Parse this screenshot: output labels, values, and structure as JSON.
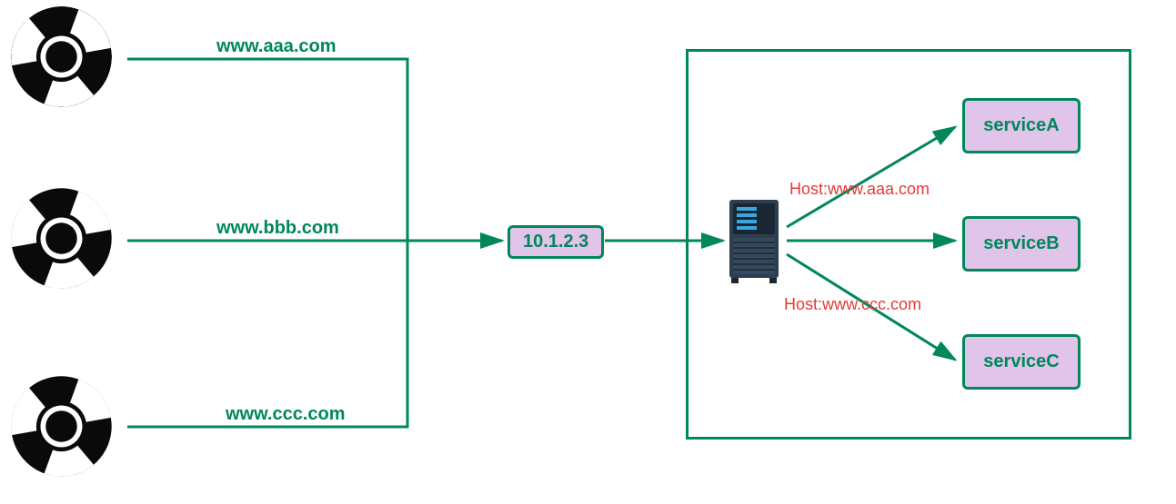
{
  "browsers": [
    {
      "domain": "www.aaa.com"
    },
    {
      "domain": "www.bbb.com"
    },
    {
      "domain": "www.ccc.com"
    }
  ],
  "ip": "10.1.2.3",
  "services": [
    {
      "name": "serviceA"
    },
    {
      "name": "serviceB"
    },
    {
      "name": "serviceC"
    }
  ],
  "host_labels": [
    "Host:www.aaa.com",
    "Host:www.ccc.com"
  ],
  "colors": {
    "green": "#00875a",
    "purple": "#e1c4e9",
    "red": "#e53935"
  }
}
